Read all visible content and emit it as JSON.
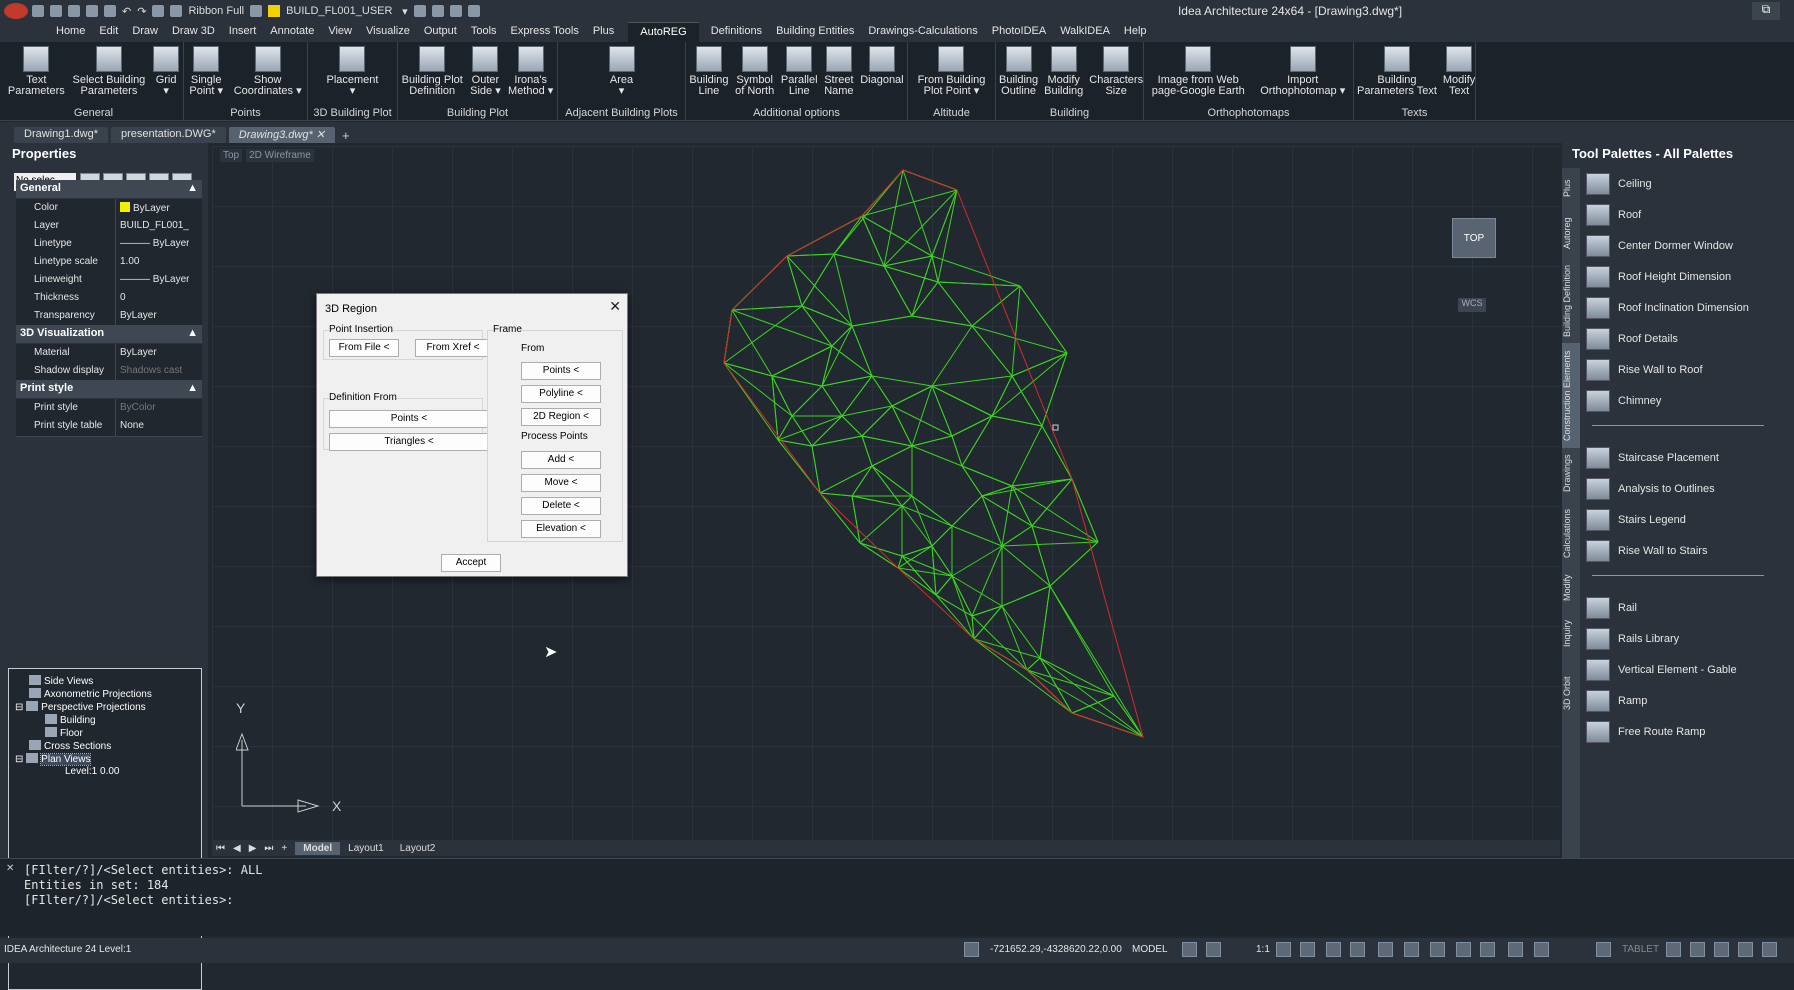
{
  "window": {
    "title": "Idea Architecture 24x64 - [Drawing3.dwg*]",
    "layer_combo": "BUILD_FL001_USER",
    "ribbon_mode": "Ribbon Full"
  },
  "menu": [
    "Home",
    "Edit",
    "Draw",
    "Draw 3D",
    "Insert",
    "Annotate",
    "View",
    "Visualize",
    "Output",
    "Tools",
    "Express Tools",
    "Plus",
    "AutoREG",
    "Definitions",
    "Building Entities",
    "Drawings-Calculations",
    "PhotoIDEA",
    "WalkIDEA",
    "Help"
  ],
  "active_menu": "AutoREG",
  "ribbon": {
    "general": {
      "name": "General",
      "b1": "Text\nParameters",
      "b2": "Select Building\nParameters",
      "b3": "Grid\n▾"
    },
    "points": {
      "name": "Points",
      "b1": "Single\nPoint ▾",
      "b2": "Show\nCoordinates ▾"
    },
    "bplot3d": {
      "name": "3D Building Plot",
      "b1": "Placement\n▾"
    },
    "bplot": {
      "name": "Building Plot",
      "b1": "Building Plot\nDefinition",
      "b2": "Outer\nSide ▾",
      "b3": "Irona's\nMethod ▾"
    },
    "adjacent": {
      "name": "Adjacent Building Plots",
      "b1": "Area\n▾"
    },
    "additional": {
      "name": "Additional options",
      "b1": "Building\nLine",
      "b2": "Symbol\nof North",
      "b3": "Parallel\nLine",
      "b4": "Street\nName",
      "b5": "Diagonal"
    },
    "altitude": {
      "name": "Altitude",
      "b1": "From Building\nPlot Point ▾"
    },
    "building": {
      "name": "Building",
      "b1": "Building\nOutline",
      "b2": "Modify\nBuilding",
      "b3": "Characters\nSize"
    },
    "ortho": {
      "name": "Orthophotomaps",
      "b1": "Image from Web\npage-Google Earth",
      "b2": "Import\nOrthophotomap ▾"
    },
    "texts": {
      "name": "Texts",
      "b1": "Building\nParameters Text",
      "b2": "Modify\nText"
    }
  },
  "doc_tabs": [
    "Drawing1.dwg*",
    "presentation.DWG*",
    "Drawing3.dwg*"
  ],
  "properties": {
    "title": "Properties",
    "selection": "No selec",
    "general": {
      "header": "General",
      "rows": [
        {
          "k": "Color",
          "v": "ByLayer"
        },
        {
          "k": "Layer",
          "v": "BUILD_FL001_"
        },
        {
          "k": "Linetype",
          "v": "——— ByLayer"
        },
        {
          "k": "Linetype scale",
          "v": "1.00"
        },
        {
          "k": "Lineweight",
          "v": "——— ByLayer"
        },
        {
          "k": "Thickness",
          "v": "0"
        },
        {
          "k": "Transparency",
          "v": "ByLayer"
        }
      ]
    },
    "viz": {
      "header": "3D Visualization",
      "rows": [
        {
          "k": "Material",
          "v": "ByLayer"
        },
        {
          "k": "Shadow display",
          "v": "Shadows cast"
        }
      ]
    },
    "print": {
      "header": "Print style",
      "rows": [
        {
          "k": "Print style",
          "v": "ByColor"
        },
        {
          "k": "Print style table",
          "v": "None"
        }
      ]
    }
  },
  "tree": {
    "side": "Side Views",
    "axo": "Axonometric Projections",
    "persp": "Perspective Projections",
    "building": "Building",
    "floor": "Floor",
    "cross": "Cross Sections",
    "plan": "Plan Views",
    "level": "Level:1  0.00"
  },
  "viewport": {
    "view": "Top",
    "style": "2D Wireframe",
    "cube": "TOP",
    "wcs": "WCS",
    "axis_y": "Y",
    "axis_x": "X"
  },
  "layout_tabs": [
    "Model",
    "Layout1",
    "Layout2"
  ],
  "palette": {
    "title": "Tool Palettes - All Palettes",
    "tabs": [
      "Plus",
      "Autoreg",
      "Building Definition",
      "Construction Elements",
      "Drawings",
      "Calculations",
      "Modify",
      "Inquiry",
      "3D Orbit"
    ],
    "group1": [
      "Ceiling",
      "Roof",
      "Center Dormer Window",
      "Roof Height Dimension",
      "Roof Inclination Dimension",
      "Roof Details",
      "Rise Wall to Roof",
      "Chimney"
    ],
    "group2": [
      "Staircase Placement",
      "Analysis to Outlines",
      "Stairs Legend",
      "Rise Wall to Stairs"
    ],
    "group3": [
      "Rail",
      "Rails Library",
      "Vertical Element - Gable",
      "Ramp",
      "Free Route Ramp"
    ]
  },
  "dialog": {
    "title": "3D Region",
    "point_insertion": "Point Insertion",
    "from_file": "From File <",
    "from_xref": "From Xref <",
    "definition_from": "Definition From",
    "def_points": "Points <",
    "triangles": "Triangles <",
    "frame": "Frame",
    "from": "From",
    "f_points": "Points <",
    "polyline": "Polyline <",
    "region2d": "2D Region <",
    "process_points": "Process Points",
    "add": "Add <",
    "move": "Move <",
    "delete": "Delete <",
    "elevation": "Elevation <",
    "accept": "Accept"
  },
  "command": {
    "lines": "[FIlter/?]/<Select entities>: ALL\nEntities in set: 184\n[FIlter/?]/<Select entities>:"
  },
  "status": {
    "left": "IDEA Architecture 24 Level:1",
    "coords": "-721652.29,-4328620.22,0.00",
    "model": "MODEL",
    "scale": "1:1",
    "tablet": "TABLET"
  },
  "colors": {
    "mesh": "#3ad41e",
    "boundary": "#d62a2a",
    "accent": "#2b323b"
  }
}
